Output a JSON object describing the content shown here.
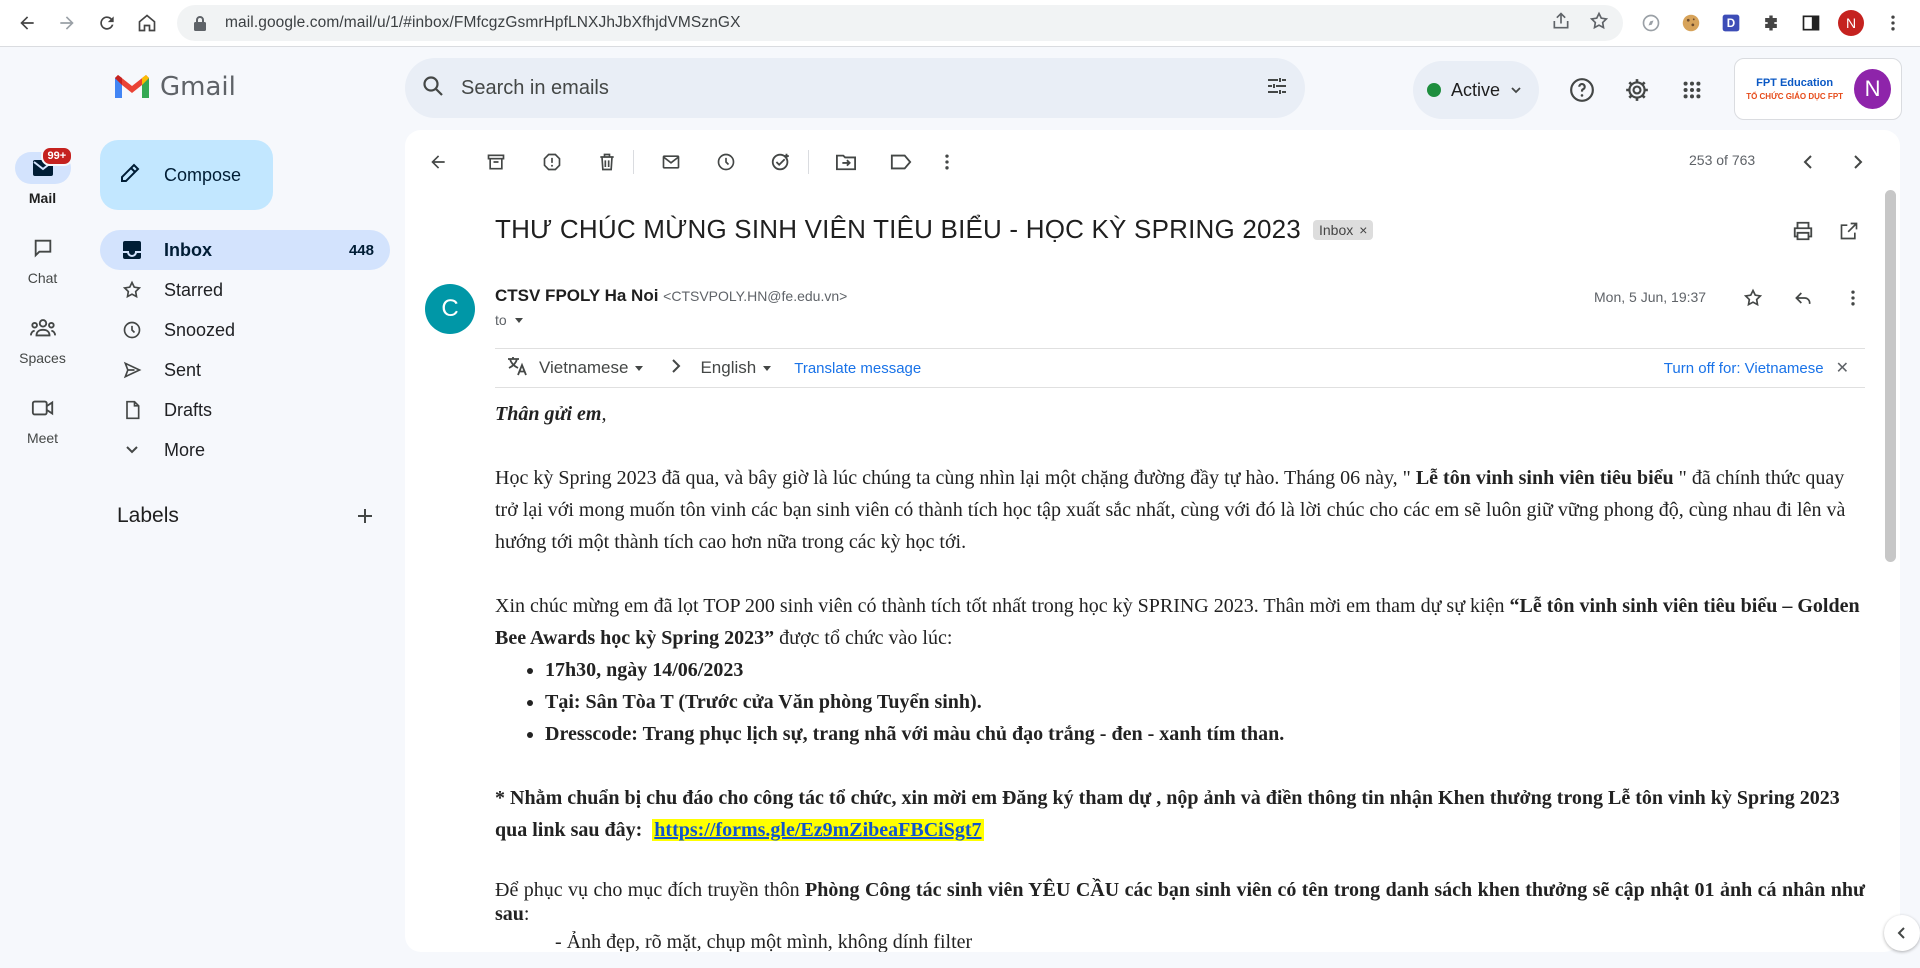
{
  "browser": {
    "url": "mail.google.com/mail/u/1/#inbox/FMfcgzGsmrHpfLNXJhJbXfhjdVMSznGX",
    "profile_initial": "N"
  },
  "rail": {
    "mail_label": "Mail",
    "mail_badge": "99+",
    "chat_label": "Chat",
    "spaces_label": "Spaces",
    "meet_label": "Meet"
  },
  "app": {
    "logo_text": "Gmail",
    "search_placeholder": "Search in emails",
    "status_label": "Active",
    "account_initial": "N",
    "org_logo_text": "FPT Education",
    "org_tagline": "TỔ CHỨC GIÁO DỤC FPT"
  },
  "sidebar": {
    "compose_label": "Compose",
    "items": [
      {
        "label": "Inbox",
        "count": "448",
        "icon": "inbox-icon"
      },
      {
        "label": "Starred",
        "count": "",
        "icon": "star-icon"
      },
      {
        "label": "Snoozed",
        "count": "",
        "icon": "clock-icon"
      },
      {
        "label": "Sent",
        "count": "",
        "icon": "send-icon"
      },
      {
        "label": "Drafts",
        "count": "",
        "icon": "draft-icon"
      },
      {
        "label": "More",
        "count": "",
        "icon": "chevron-down-icon"
      }
    ],
    "labels_heading": "Labels"
  },
  "toolbar": {
    "pager_text": "253 of 763"
  },
  "email": {
    "subject": "THƯ CHÚC MỪNG SINH VIÊN TIÊU BIỂU - HỌC KỲ SPRING 2023",
    "label_chip": "Inbox",
    "sender_initial": "C",
    "sender_name": "CTSV FPOLY Ha Noi",
    "sender_email": "<CTSVPOLY.HN@fe.edu.vn>",
    "to_text": "to",
    "date": "Mon, 5 Jun, 19:37",
    "translate": {
      "from_lang": "Vietnamese",
      "to_lang": "English",
      "translate_link": "Translate message",
      "turn_off": "Turn off for: Vietnamese"
    },
    "greeting": "Thân gửi em",
    "para1_a": "Học kỳ Spring 2023 đã qua, và bây giờ là lúc chúng ta cùng nhìn lại một chặng đường đầy tự hào. Tháng 06 này, \"",
    "para1_b": " Lễ tôn vinh sinh viên tiêu biểu ",
    "para1_c": "\" đã chính thức quay trở lại với mong muốn tôn vinh các bạn sinh viên có thành tích học tập xuất sắc nhất, cùng với đó là lời chúc cho các em sẽ luôn giữ vững phong độ, cùng nhau đi lên và hướng tới một thành tích cao hơn nữa trong các kỳ học tới.",
    "para2_a": "Xin chúc mừng em đã lọt TOP 200 sinh viên có thành tích tốt nhất trong học kỳ SPRING 2023. Thân mời em tham dự sự kiện ",
    "para2_b": "“Lễ tôn vinh sinh viên tiêu biểu – Golden Bee Awards học kỳ Spring 2023”",
    "para2_c": " được tổ chức vào lúc:",
    "details": [
      "17h30, ngày 14/06/2023",
      "Tại: Sân Tòa T (Trước cửa Văn phòng Tuyển sinh).",
      "Dresscode:  Trang phục lịch sự, trang nhã với màu chủ đạo trắng - đen - xanh tím than."
    ],
    "para3": "* Nhằm chuẩn bị chu đáo cho công tác tổ chức, xin mời em Đăng ký tham dự , nộp ảnh và điền thông tin nhận Khen thưởng trong Lễ tôn vinh kỳ Spring 2023 qua link sau đây:",
    "form_link": "https://forms.gle/Ez9mZibeaFBCiSgt7",
    "para4_a": "Để phục vụ cho mục đích truyền thôn ",
    "para4_b": "Phòng Công tác sinh viên YÊU CẦU các bạn sinh viên có tên trong danh sách khen thưởng sẽ cập nhật 01 ảnh cá nhân như sau",
    "para4_c": ":",
    "sub_item": "- Ảnh đẹp, rõ mặt, chụp một mình, không dính filter"
  }
}
